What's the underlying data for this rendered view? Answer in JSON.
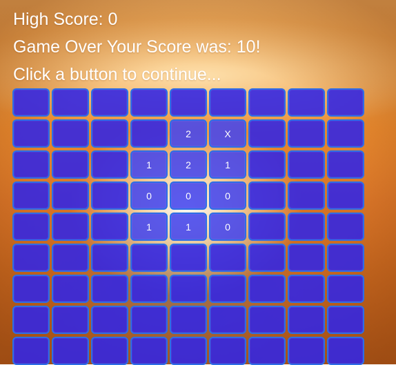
{
  "hud": {
    "high_score": "High Score: 0",
    "game_over": "Game Over Your Score was: 10!",
    "prompt": "Click a button to continue..."
  },
  "board": {
    "rows": 9,
    "cols": 9,
    "cells": [
      [
        "",
        "",
        "",
        "",
        "",
        "",
        "",
        "",
        ""
      ],
      [
        "",
        "",
        "",
        "",
        "2",
        "X",
        "",
        "",
        ""
      ],
      [
        "",
        "",
        "",
        "1",
        "2",
        "1",
        "",
        "",
        ""
      ],
      [
        "",
        "",
        "",
        "0",
        "0",
        "0",
        "",
        "",
        ""
      ],
      [
        "",
        "",
        "",
        "1",
        "1",
        "0",
        "",
        "",
        ""
      ],
      [
        "",
        "",
        "",
        "",
        "",
        "",
        "",
        "",
        ""
      ],
      [
        "",
        "",
        "",
        "",
        "",
        "",
        "",
        "",
        ""
      ],
      [
        "",
        "",
        "",
        "",
        "",
        "",
        "",
        "",
        ""
      ],
      [
        "",
        "",
        "",
        "",
        "",
        "",
        "",
        "",
        ""
      ]
    ]
  },
  "colors": {
    "cell_fill": "#3427e2",
    "cell_border": "#2d6ee6",
    "text": "#ffffff",
    "background": "#e98a2f"
  }
}
